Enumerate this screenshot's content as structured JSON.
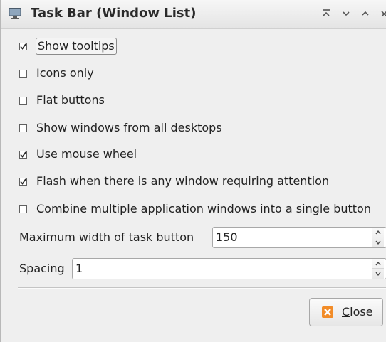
{
  "window": {
    "title": "Task Bar (Window List)",
    "title_icon": "monitor-icon",
    "controls": [
      "shade-icon",
      "minimize-icon",
      "maximize-icon",
      "close-icon"
    ]
  },
  "options": [
    {
      "label": "Show tooltips",
      "checked": true
    },
    {
      "label": "Icons only",
      "checked": false
    },
    {
      "label": "Flat buttons",
      "checked": false
    },
    {
      "label": "Show windows from all desktops",
      "checked": false
    },
    {
      "label": "Use mouse wheel",
      "checked": true
    },
    {
      "label": "Flash when there is any window requiring attention",
      "checked": true
    },
    {
      "label": "Combine multiple application windows into a single button",
      "checked": false
    }
  ],
  "max_width": {
    "label": "Maximum width of task button",
    "value": "150"
  },
  "spacing": {
    "label": "Spacing",
    "value": "1"
  },
  "close_button": {
    "mnemonic": "C",
    "rest": "lose",
    "icon": "close-icon"
  },
  "colors": {
    "background": "#efefef",
    "close_icon": "#f28c28"
  }
}
